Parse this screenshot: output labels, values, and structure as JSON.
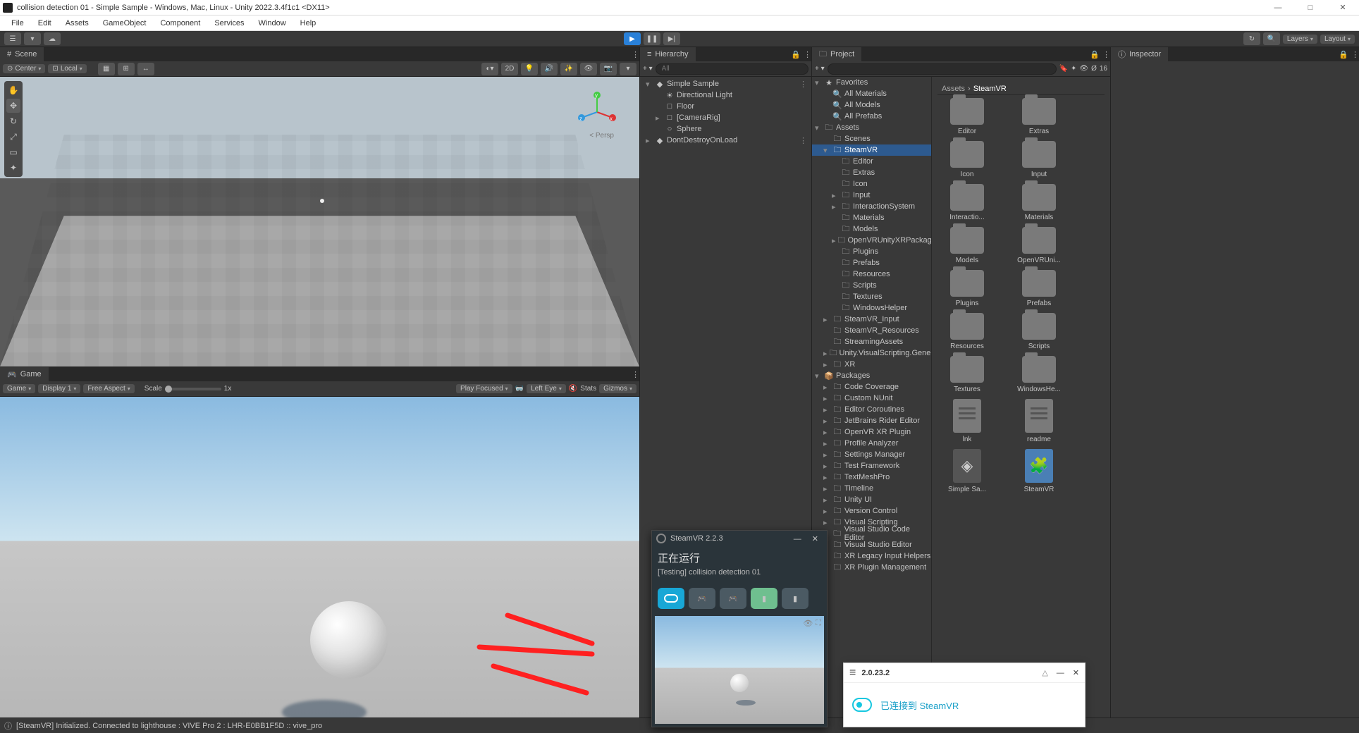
{
  "titlebar": {
    "title": "collision detection 01 - Simple Sample - Windows, Mac, Linux - Unity 2022.3.4f1c1 <DX11>"
  },
  "menu": [
    "File",
    "Edit",
    "Assets",
    "GameObject",
    "Component",
    "Services",
    "Window",
    "Help"
  ],
  "play": {
    "playing": true
  },
  "toolbar_right": {
    "layers": "Layers",
    "layout": "Layout"
  },
  "scene_tab": "Scene",
  "game_tab": "Game",
  "scene_toolbar": {
    "pivot": "Center",
    "space": "Local",
    "mode2d": "2D"
  },
  "scene_persp": "< Persp",
  "game_toolbar": {
    "game": "Game",
    "display": "Display 1",
    "aspect": "Free Aspect",
    "scale": "Scale",
    "scale_val": "1x",
    "focus": "Play Focused",
    "eye": "Left Eye",
    "stats": "Stats",
    "gizmos": "Gizmos"
  },
  "hierarchy": {
    "tab": "Hierarchy",
    "search_placeholder": "All",
    "items": [
      {
        "depth": 0,
        "fold": "▾",
        "icon": "◆",
        "label": "Simple Sample",
        "menu": true
      },
      {
        "depth": 1,
        "fold": "",
        "icon": "☀",
        "label": "Directional Light"
      },
      {
        "depth": 1,
        "fold": "",
        "icon": "□",
        "label": "Floor"
      },
      {
        "depth": 1,
        "fold": "▸",
        "icon": "□",
        "label": "[CameraRig]"
      },
      {
        "depth": 1,
        "fold": "",
        "icon": "○",
        "label": "Sphere"
      },
      {
        "depth": 0,
        "fold": "▸",
        "icon": "◆",
        "label": "DontDestroyOnLoad",
        "menu": true
      }
    ]
  },
  "project": {
    "tab": "Project",
    "search_placeholder": "",
    "count": "16",
    "breadcrumb": [
      "Assets",
      "SteamVR"
    ],
    "favorites_label": "Favorites",
    "favorites": [
      "All Materials",
      "All Models",
      "All Prefabs"
    ],
    "assets_label": "Assets",
    "assets_tree": [
      {
        "d": 1,
        "f": "",
        "l": "Scenes"
      },
      {
        "d": 1,
        "f": "▾",
        "l": "SteamVR",
        "sel": true
      },
      {
        "d": 2,
        "f": "",
        "l": "Editor"
      },
      {
        "d": 2,
        "f": "",
        "l": "Extras"
      },
      {
        "d": 2,
        "f": "",
        "l": "Icon"
      },
      {
        "d": 2,
        "f": "▸",
        "l": "Input"
      },
      {
        "d": 2,
        "f": "▸",
        "l": "InteractionSystem"
      },
      {
        "d": 2,
        "f": "",
        "l": "Materials"
      },
      {
        "d": 2,
        "f": "",
        "l": "Models"
      },
      {
        "d": 2,
        "f": "▸",
        "l": "OpenVRUnityXRPackage"
      },
      {
        "d": 2,
        "f": "",
        "l": "Plugins"
      },
      {
        "d": 2,
        "f": "",
        "l": "Prefabs"
      },
      {
        "d": 2,
        "f": "",
        "l": "Resources"
      },
      {
        "d": 2,
        "f": "",
        "l": "Scripts"
      },
      {
        "d": 2,
        "f": "",
        "l": "Textures"
      },
      {
        "d": 2,
        "f": "",
        "l": "WindowsHelper"
      },
      {
        "d": 1,
        "f": "▸",
        "l": "SteamVR_Input"
      },
      {
        "d": 1,
        "f": "",
        "l": "SteamVR_Resources"
      },
      {
        "d": 1,
        "f": "",
        "l": "StreamingAssets"
      },
      {
        "d": 1,
        "f": "▸",
        "l": "Unity.VisualScripting.Generated"
      },
      {
        "d": 1,
        "f": "▸",
        "l": "XR"
      }
    ],
    "packages_label": "Packages",
    "packages": [
      "Code Coverage",
      "Custom NUnit",
      "Editor Coroutines",
      "JetBrains Rider Editor",
      "OpenVR XR Plugin",
      "Profile Analyzer",
      "Settings Manager",
      "Test Framework",
      "TextMeshPro",
      "Timeline",
      "Unity UI",
      "Version Control",
      "Visual Scripting",
      "Visual Studio Code Editor",
      "Visual Studio Editor",
      "XR Legacy Input Helpers",
      "XR Plugin Management"
    ],
    "grid": [
      {
        "t": "folder",
        "l": "Editor"
      },
      {
        "t": "folder",
        "l": "Extras"
      },
      {
        "t": "folder",
        "l": "Icon"
      },
      {
        "t": "folder",
        "l": "Input"
      },
      {
        "t": "folder",
        "l": "Interactio..."
      },
      {
        "t": "folder",
        "l": "Materials"
      },
      {
        "t": "folder",
        "l": "Models"
      },
      {
        "t": "folder",
        "l": "OpenVRUni..."
      },
      {
        "t": "folder",
        "l": "Plugins"
      },
      {
        "t": "folder",
        "l": "Prefabs"
      },
      {
        "t": "folder",
        "l": "Resources"
      },
      {
        "t": "folder",
        "l": "Scripts"
      },
      {
        "t": "folder",
        "l": "Textures"
      },
      {
        "t": "folder",
        "l": "WindowsHe..."
      },
      {
        "t": "file",
        "l": "lnk"
      },
      {
        "t": "file",
        "l": "readme"
      },
      {
        "t": "asset",
        "l": "Simple Sa..."
      },
      {
        "t": "prefab",
        "l": "SteamVR"
      }
    ]
  },
  "inspector": {
    "tab": "Inspector"
  },
  "status": {
    "icon": "ⓘ",
    "text": "[SteamVR] Initialized. Connected to lighthouse : VIVE Pro 2 : LHR-E0BB1F5D :: vive_pro"
  },
  "steamvr_popup": {
    "title": "SteamVR 2.2.3",
    "status": "正在运行",
    "testing": "[Testing] collision detection 01"
  },
  "vive_popup": {
    "version": "2.0.23.2",
    "message": "已连接到 SteamVR"
  }
}
